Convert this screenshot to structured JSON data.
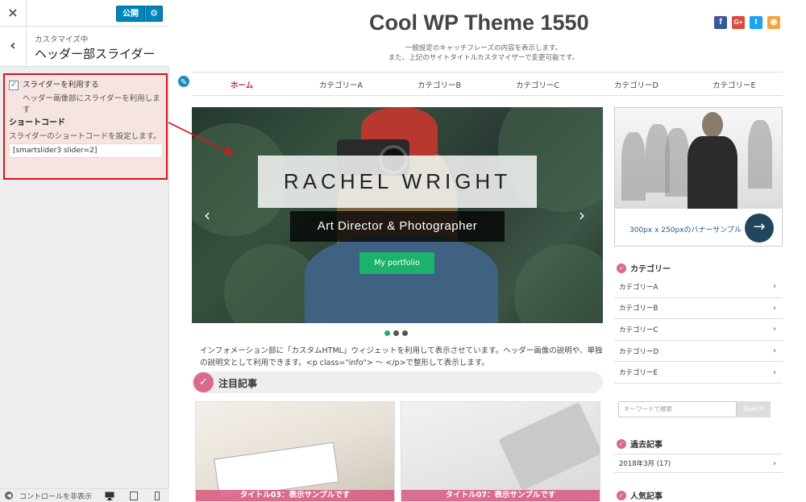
{
  "customizer": {
    "close_icon": "×",
    "publish_label": "公開",
    "gear_icon": "⚙",
    "back_icon": "‹",
    "customizing_label": "カスタマイズ中",
    "section_title": "ヘッダー部スライダー",
    "slider_checkbox": {
      "checked": true,
      "label": "スライダーを利用する",
      "description": "ヘッダー画像部にスライダーを利用します"
    },
    "shortcode": {
      "title": "ショートコード",
      "description": "スライダーのショートコードを設定します。",
      "value": "[smartslider3 slider=2]"
    },
    "footer": {
      "hide_controls_label": "コントロールを非表示",
      "devices": [
        "desktop-icon",
        "tablet-icon",
        "mobile-icon"
      ]
    }
  },
  "site": {
    "title": "Cool WP Theme 1550",
    "tagline_1": "一般設定のキャッチフレーズの内容を表示します。",
    "tagline_2": "また、上記のサイトタイトルカスタマイザーで変更可能です。",
    "social": [
      {
        "name": "facebook-icon",
        "glyph": "f",
        "color": "#3b5998"
      },
      {
        "name": "google-plus-icon",
        "glyph": "G+",
        "color": "#dd4b39"
      },
      {
        "name": "twitter-icon",
        "glyph": "t",
        "color": "#1da1f2"
      },
      {
        "name": "rss-icon",
        "glyph": "◉",
        "color": "#f7a33a"
      }
    ],
    "nav": [
      "ホーム",
      "カテゴリーA",
      "カテゴリーB",
      "カテゴリーC",
      "カテゴリーD",
      "カテゴリーE"
    ],
    "slider": {
      "name": "RACHEL WRIGHT",
      "subtitle": "Art Director & Photographer",
      "button": "My portfolio",
      "dots_total": 3,
      "active_dot": 1
    },
    "info_text": "インフォメーション部に「カスタムHTML」ウィジェットを利用して表示させています。ヘッダー画像の説明や、単独の説明文として利用できます。<p class=\"info\"> 〜 </p>で整形して表示します。",
    "featured_title": "注目記事",
    "cards": [
      {
        "caption": "タイトル03：表示サンプルです"
      },
      {
        "caption": "タイトル07：表示サンプルです"
      }
    ],
    "sidebar": {
      "banner_text": "300px x 250pxのバナーサンプル",
      "categories_title": "カテゴリー",
      "categories": [
        "カテゴリーA",
        "カテゴリーB",
        "カテゴリーC",
        "カテゴリーD",
        "カテゴリーE"
      ],
      "search_placeholder": "キーワードで検索",
      "search_button": "Search",
      "archive_title": "過去記事",
      "archive_item": "2018年3月 (17)",
      "popular_title": "人気記事"
    }
  },
  "colors": {
    "accent_pink": "#d96a89",
    "nav_active": "#c7243a",
    "publish_blue": "#0085ba",
    "highlight_red": "#d9151e",
    "green": "#1bb26b"
  }
}
